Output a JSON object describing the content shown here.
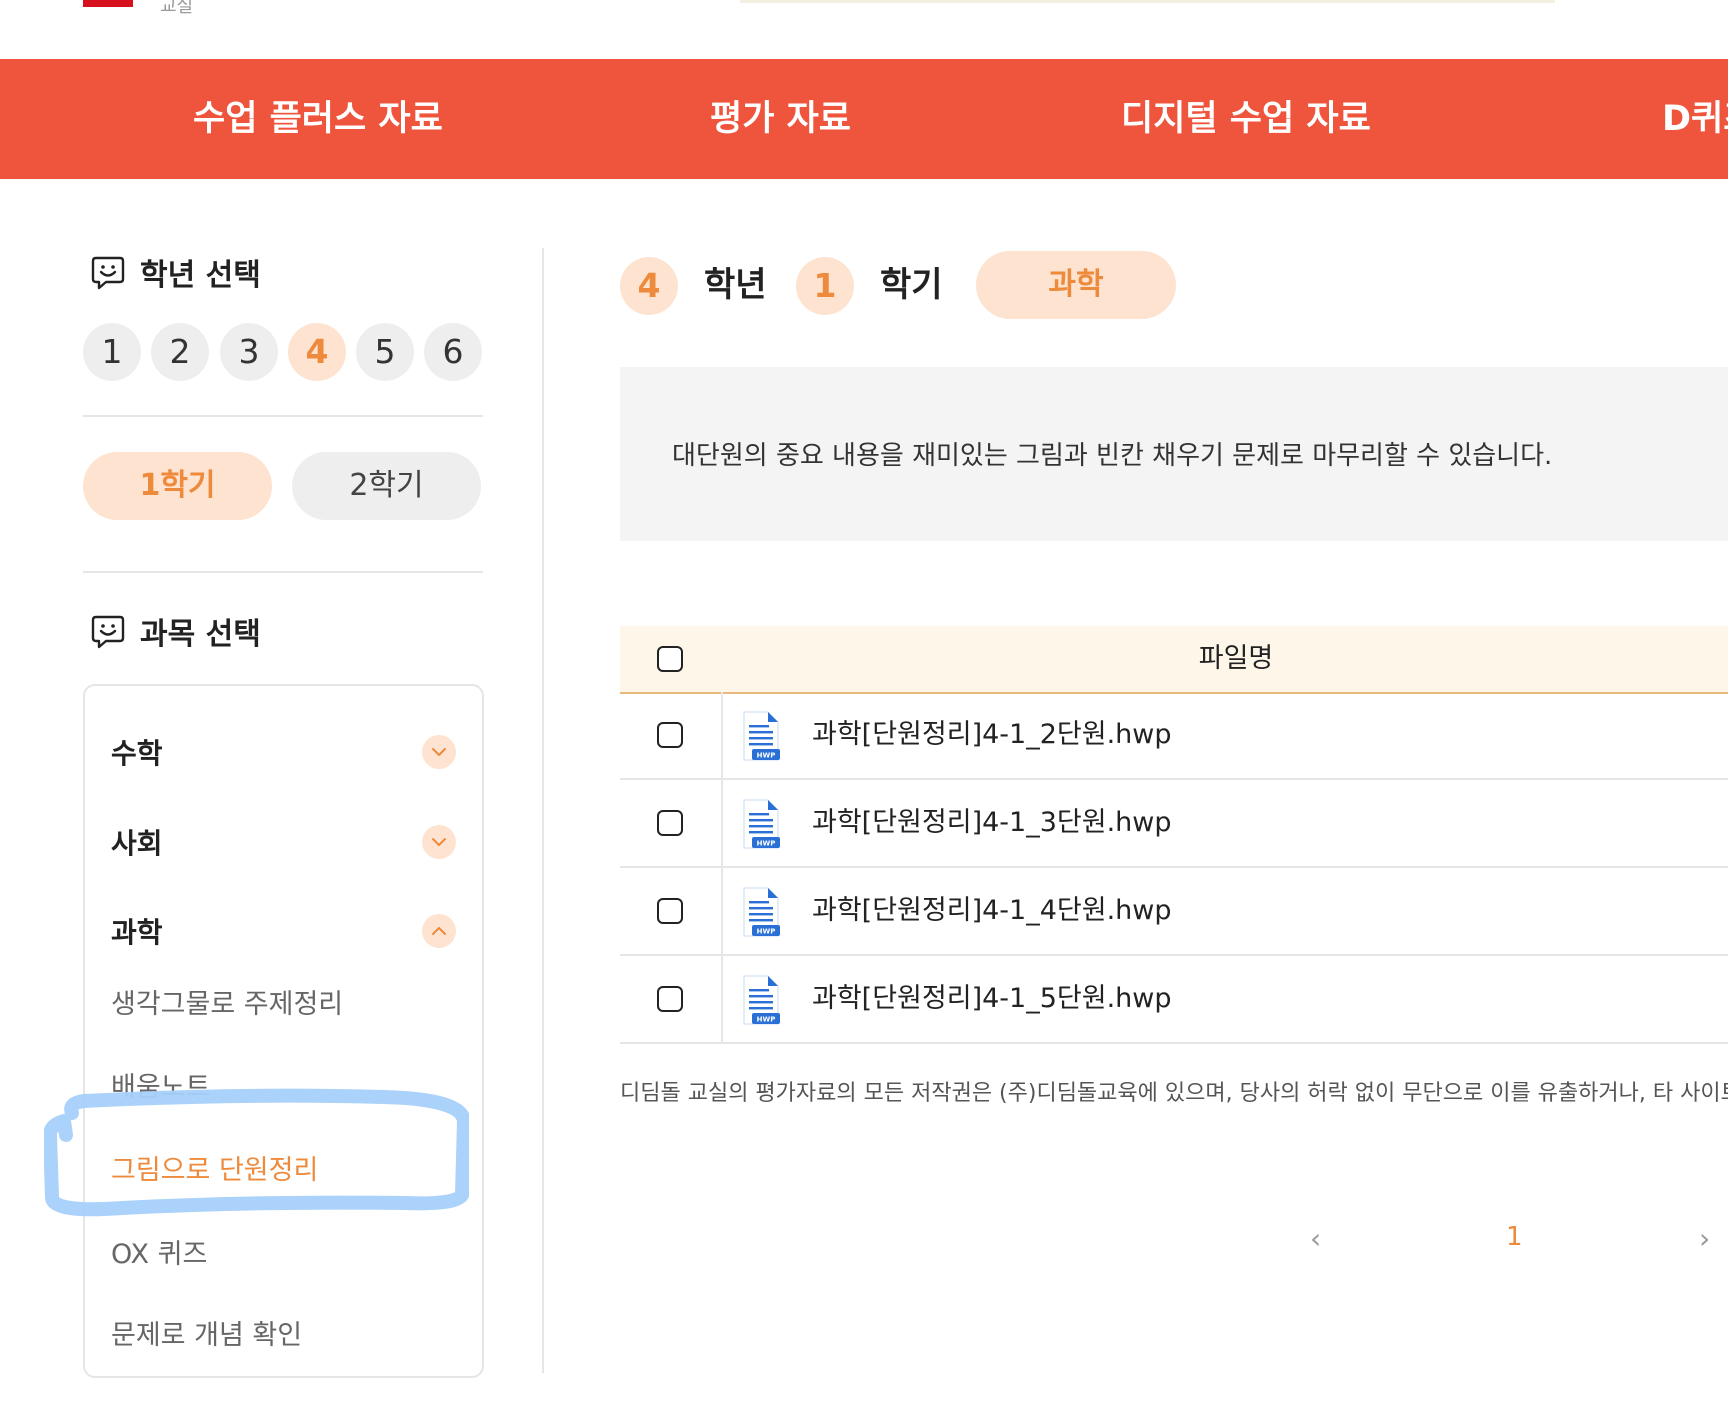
{
  "header": {
    "logo_text": "교실"
  },
  "nav": {
    "items": [
      {
        "label": "수업 플러스 자료"
      },
      {
        "label": "평가 자료"
      },
      {
        "label": "디지털 수업 자료"
      },
      {
        "label": "D퀴즈"
      }
    ]
  },
  "sidebar": {
    "grade_heading": "학년 선택",
    "grades": [
      "1",
      "2",
      "3",
      "4",
      "5",
      "6"
    ],
    "selected_grade": "4",
    "semesters": [
      {
        "label": "1학기",
        "active": true
      },
      {
        "label": "2학기",
        "active": false
      }
    ],
    "subject_heading": "과목 선택",
    "subjects": [
      {
        "label": "수학",
        "expanded": false
      },
      {
        "label": "사회",
        "expanded": false
      },
      {
        "label": "과학",
        "expanded": true
      }
    ],
    "science_items": [
      {
        "label": "생각그물로 주제정리",
        "active": false
      },
      {
        "label": "배움노트",
        "active": false
      },
      {
        "label": "그림으로 단원정리",
        "active": true
      },
      {
        "label": "OX 퀴즈",
        "active": false
      },
      {
        "label": "문제로 개념 확인",
        "active": false
      }
    ]
  },
  "main": {
    "grade_num": "4",
    "grade_unit": "학년",
    "semester_num": "1",
    "semester_unit": "학기",
    "subject": "과학",
    "description": "대단원의 중요 내용을 재미있는 그림과 빈칸 채우기 문제로 마무리할 수 있습니다.",
    "table_header": "파일명",
    "files": [
      {
        "name": "과학[단원정리]4-1_2단원.hwp",
        "icon": "hwp-file-icon"
      },
      {
        "name": "과학[단원정리]4-1_3단원.hwp",
        "icon": "hwp-file-icon"
      },
      {
        "name": "과학[단원정리]4-1_4단원.hwp",
        "icon": "hwp-file-icon"
      },
      {
        "name": "과학[단원정리]4-1_5단원.hwp",
        "icon": "hwp-file-icon"
      }
    ],
    "notice": "디딤돌 교실의 평가자료의 모든 저작권은 (주)디딤돌교육에 있으며, 당사의 허락 없이 무단으로 이를 유출하거나, 타 사이트",
    "pager": {
      "prev": "‹",
      "page": "1",
      "next": "›"
    }
  },
  "colors": {
    "nav_bg": "#ef553d",
    "accent": "#ee8a3c",
    "accent_bg": "#fde3d0",
    "highlight_marker": "#a6d0fa"
  }
}
